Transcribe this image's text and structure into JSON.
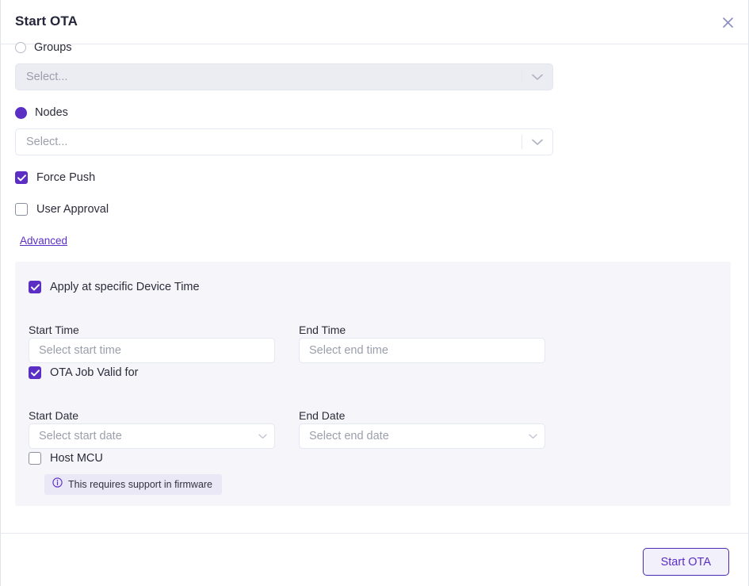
{
  "header": {
    "title": "Start OTA",
    "close_icon": "close-icon"
  },
  "target_selection": {
    "groups": {
      "label": "Groups",
      "selected": false,
      "select_placeholder": "Select...",
      "disabled": true,
      "chevron_icon": "chevron-down-icon"
    },
    "nodes": {
      "label": "Nodes",
      "selected": true,
      "select_placeholder": "Select...",
      "disabled": false,
      "chevron_icon": "chevron-down-icon"
    }
  },
  "options": {
    "force_push": {
      "label": "Force Push",
      "checked": true
    },
    "user_approval": {
      "label": "User Approval",
      "checked": false
    },
    "advanced_link": "Advanced"
  },
  "advanced": {
    "apply_device_time": {
      "label": "Apply at specific Device Time",
      "checked": true
    },
    "start_time": {
      "label": "Start Time",
      "value": "",
      "placeholder": "Select start time"
    },
    "end_time": {
      "label": "End Time",
      "value": "",
      "placeholder": "Select end time"
    },
    "ota_job_valid": {
      "label": "OTA Job Valid for",
      "checked": true
    },
    "start_date": {
      "label": "Start Date",
      "value": "",
      "placeholder": "Select start date",
      "chevron_icon": "chevron-down-icon"
    },
    "end_date": {
      "label": "End Date",
      "value": "",
      "placeholder": "Select end date",
      "chevron_icon": "chevron-down-icon"
    },
    "host_mcu": {
      "label": "Host MCU",
      "checked": false
    },
    "host_mcu_note": {
      "text": "This requires support in firmware",
      "icon": "info-circle-icon"
    }
  },
  "footer": {
    "submit_label": "Start OTA"
  },
  "colors": {
    "accent": "#5b2ec4",
    "accent_border": "#4a2ab0",
    "panel_bg": "#f5f5fa",
    "pill_bg": "#eae7f7",
    "text": "#2c2c3a",
    "placeholder": "#9b9fab",
    "field_border": "#e3e8f2",
    "disabled_bg": "#ebedf2"
  }
}
